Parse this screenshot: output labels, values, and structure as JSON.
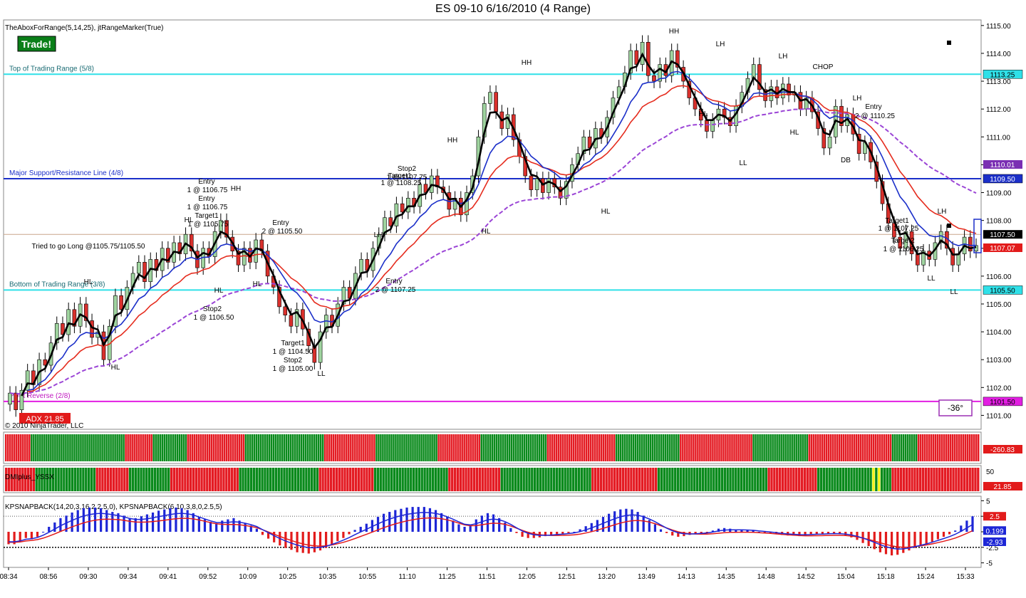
{
  "title": "ES 09-10  6/16/2010 (4 Range)",
  "indicator_label": "TheAboxForRange(5,14,25), jtRangeMarker(True)",
  "trade_badge": "Trade!",
  "copyright": "© 2010 NinjaTrader, LLC",
  "adx_badge": "ADX 21.85",
  "angle_box": "-36°",
  "panel2_label": "DMIplus_YSSX",
  "panel3_label": "KPSNAPBACK(14,20,3,16,2,2.5,0), KPSNAPBACK(6,10,3,8,0,2.5,5)",
  "colors": {
    "up_candle": "#9fd49f",
    "down_candle": "#d9302c",
    "cyan_line": "#2fe0e8",
    "blue_line": "#1b2fc9",
    "magenta_line": "#e21ee2",
    "black_ma": "#000000",
    "red_ma": "#e52c1e",
    "purple_ma": "#9b45d6",
    "hist_blue": "#1d26d6",
    "hist_red": "#e21b1b",
    "bar_green": "#0a8a1c",
    "bar_red": "#e41b23",
    "bar_yellow": "#f3f317"
  },
  "chart_data": {
    "type": "candlestick",
    "ylim": [
      1100.5,
      1115.2
    ],
    "yticks": [
      "1115.00",
      "1114.00",
      "1113.00",
      "1112.00",
      "1111.00",
      "1110.00",
      "1109.00",
      "1108.00",
      "1107.00",
      "1106.00",
      "1105.00",
      "1104.00",
      "1103.00",
      "1102.00",
      "1101.00"
    ],
    "xticks": [
      "08:34",
      "08:56",
      "09:30",
      "09:34",
      "09:41",
      "09:52",
      "10:09",
      "10:25",
      "10:35",
      "10:55",
      "11:10",
      "11:25",
      "11:51",
      "12:05",
      "12:51",
      "13:20",
      "13:49",
      "14:13",
      "14:35",
      "14:48",
      "14:52",
      "15:04",
      "15:18",
      "15:24",
      "15:33"
    ],
    "closes": [
      1101.8,
      1101.2,
      1101.9,
      1102.6,
      1102.1,
      1103.0,
      1102.8,
      1103.6,
      1104.3,
      1103.9,
      1104.8,
      1104.2,
      1105.0,
      1104.4,
      1103.8,
      1104.0,
      1103.0,
      1104.2,
      1105.3,
      1104.8,
      1105.6,
      1106.1,
      1106.5,
      1105.8,
      1106.6,
      1106.2,
      1107.0,
      1106.5,
      1107.2,
      1106.8,
      1107.5,
      1106.9,
      1106.3,
      1107.0,
      1106.7,
      1107.6,
      1108.0,
      1107.4,
      1106.9,
      1106.4,
      1107.0,
      1106.5,
      1107.3,
      1106.9,
      1106.0,
      1105.6,
      1104.9,
      1104.6,
      1104.2,
      1104.8,
      1104.1,
      1103.5,
      1102.9,
      1104.0,
      1104.6,
      1104.2,
      1105.0,
      1105.6,
      1105.2,
      1106.1,
      1106.6,
      1106.2,
      1107.0,
      1107.5,
      1108.1,
      1107.8,
      1108.6,
      1108.3,
      1108.8,
      1108.5,
      1109.3,
      1109.0,
      1109.6,
      1109.2,
      1109.0,
      1108.4,
      1108.8,
      1108.2,
      1109.0,
      1109.6,
      1111.0,
      1112.2,
      1112.6,
      1111.9,
      1111.3,
      1111.8,
      1110.9,
      1110.3,
      1109.6,
      1109.1,
      1109.5,
      1109.0,
      1109.5,
      1109.2,
      1108.8,
      1109.4,
      1110.0,
      1110.4,
      1111.0,
      1110.6,
      1111.3,
      1111.0,
      1111.7,
      1112.4,
      1112.8,
      1113.3,
      1114.1,
      1113.6,
      1114.4,
      1113.2,
      1113.0,
      1113.6,
      1113.2,
      1114.1,
      1113.5,
      1113.0,
      1112.4,
      1112.0,
      1111.6,
      1111.2,
      1111.6,
      1112.0,
      1111.7,
      1111.4,
      1112.1,
      1112.6,
      1113.1,
      1113.6,
      1112.7,
      1112.3,
      1112.8,
      1112.4,
      1112.9,
      1112.5,
      1112.6,
      1112.0,
      1112.4,
      1111.9,
      1111.3,
      1110.6,
      1111.0,
      1112.1,
      1111.4,
      1111.8,
      1111.1,
      1110.4,
      1110.8,
      1110.1,
      1109.4,
      1108.6,
      1107.9,
      1107.4,
      1107.0,
      1107.6,
      1106.8,
      1106.4,
      1106.9,
      1106.6,
      1107.2,
      1107.6,
      1107.0,
      1106.4,
      1106.8,
      1107.4,
      1106.9,
      1107.1
    ],
    "levels": [
      {
        "label": "Top of Trading Range (5/8)",
        "value": 1113.25,
        "tag": "1113.25"
      },
      {
        "label": "Major Support/Resistance Line (4/8)",
        "value": 1109.5,
        "tag": "1109.50"
      },
      {
        "label": "Bottom of Trading Range (3/8)",
        "value": 1105.5,
        "tag": "1105.50"
      },
      {
        "label": "Pivot Reverse (2/8)",
        "value": 1101.5,
        "tag": "1101.50"
      }
    ],
    "price_tags": [
      {
        "value": 1110.01,
        "tag": "1110.01"
      },
      {
        "value": 1107.5,
        "tag": "1107.50"
      },
      {
        "value": 1107.07,
        "tag": "1107.07"
      }
    ],
    "annotations": [
      {
        "text": "HH",
        "x": 946,
        "y": 47
      },
      {
        "text": "LH",
        "x": 1011,
        "y": 65
      },
      {
        "text": "LH",
        "x": 1099,
        "y": 82
      },
      {
        "text": "CHOP",
        "x": 1155,
        "y": 97
      },
      {
        "text": "HH",
        "x": 739,
        "y": 91
      },
      {
        "text": "HH",
        "x": 635,
        "y": 200
      },
      {
        "text": "HL",
        "x": 987,
        "y": 163
      },
      {
        "text": "HL",
        "x": 1115,
        "y": 189
      },
      {
        "text": "LL",
        "x": 1043,
        "y": 232
      },
      {
        "text": "DB",
        "x": 1187,
        "y": 228
      },
      {
        "text": "LH",
        "x": 1203,
        "y": 141
      },
      {
        "text": "Entry",
        "x": 1226,
        "y": 153
      },
      {
        "text": "2 @ 1110.25",
        "x": 1228,
        "y": 166
      },
      {
        "text": "HL",
        "x": 850,
        "y": 300
      },
      {
        "text": "HL",
        "x": 682,
        "y": 328
      },
      {
        "text": "Stop2",
        "x": 571,
        "y": 240
      },
      {
        "text": "Target1",
        "x": 561,
        "y": 250
      },
      {
        "text": "1 @ 1107.75",
        "x": 571,
        "y": 252
      },
      {
        "text": "1 @ 1108.25",
        "x": 563,
        "y": 260
      },
      {
        "text": "Entry",
        "x": 290,
        "y": 258
      },
      {
        "text": "1 @ 1106.75",
        "x": 291,
        "y": 270
      },
      {
        "text": "Entry",
        "x": 290,
        "y": 282
      },
      {
        "text": "1 @ 1106.75",
        "x": 291,
        "y": 294
      },
      {
        "text": "Target1",
        "x": 290,
        "y": 306
      },
      {
        "text": "1 @ 1105.75",
        "x": 292,
        "y": 318
      },
      {
        "text": "HH",
        "x": 331,
        "y": 268
      },
      {
        "text": "HL",
        "x": 265,
        "y": 312
      },
      {
        "text": "Entry",
        "x": 394,
        "y": 316
      },
      {
        "text": "2 @ 1105.50",
        "x": 396,
        "y": 328
      },
      {
        "text": "Tried to go Long @1105.75/1105.50",
        "x": 124,
        "y": 349
      },
      {
        "text": "LH",
        "x": 531,
        "y": 333
      },
      {
        "text": "HL",
        "x": 124,
        "y": 399
      },
      {
        "text": "HL",
        "x": 307,
        "y": 411
      },
      {
        "text": "HL",
        "x": 361,
        "y": 402
      },
      {
        "text": "Entry",
        "x": 553,
        "y": 398
      },
      {
        "text": "2 @ 1107.25",
        "x": 555,
        "y": 410
      },
      {
        "text": "Stop2",
        "x": 298,
        "y": 437
      },
      {
        "text": "1 @ 1106.50",
        "x": 300,
        "y": 449
      },
      {
        "text": "HL",
        "x": 162,
        "y": 519
      },
      {
        "text": "Target1",
        "x": 411,
        "y": 485
      },
      {
        "text": "1 @ 1104.50",
        "x": 411,
        "y": 497
      },
      {
        "text": "Stop2",
        "x": 411,
        "y": 509
      },
      {
        "text": "1 @ 1105.00",
        "x": 411,
        "y": 521
      },
      {
        "text": "LL",
        "x": 451,
        "y": 528
      },
      {
        "text": "Target1",
        "x": 1259,
        "y": 313
      },
      {
        "text": "1 @ 1107.25",
        "x": 1261,
        "y": 324
      },
      {
        "text": "Target2",
        "x": 1267,
        "y": 341
      },
      {
        "text": "1 @ 1106.25",
        "x": 1268,
        "y": 353
      },
      {
        "text": "LH",
        "x": 1322,
        "y": 300
      },
      {
        "text": "LL",
        "x": 1307,
        "y": 394
      },
      {
        "text": "LL",
        "x": 1339,
        "y": 413
      }
    ],
    "kpsnap": {
      "ylim": [
        -5.5,
        5.5
      ],
      "yticks": [
        "5",
        "2.5",
        "0",
        "-2.5",
        "-5"
      ],
      "tags": [
        "2.5",
        "0.199",
        "-2.93"
      ],
      "hist": [
        -2,
        -2,
        -1.6,
        -1,
        -1.2,
        -0.8,
        0,
        0.8,
        1.5,
        2.2,
        2.6,
        3.1,
        3.5,
        3.8,
        3.9,
        3.9,
        3.8,
        3.5,
        3.2,
        3.0,
        2.6,
        2.2,
        2.2,
        2.5,
        2.8,
        3.1,
        3.4,
        3.6,
        3.8,
        3.9,
        3.8,
        3.5,
        3.0,
        2.4,
        2.0,
        1.6,
        1.4,
        1.8,
        2.0,
        2.2,
        1.8,
        1.4,
        1.0,
        0.5,
        -0.5,
        -1.1,
        -1.7,
        -2.2,
        -2.6,
        -2.9,
        -3.3,
        -3.4,
        -3.5,
        -3.3,
        -3.0,
        -2.6,
        -2.0,
        -1.5,
        -1.0,
        -0.4,
        0.3,
        0.8,
        1.3,
        1.9,
        2.4,
        2.9,
        3.2,
        3.5,
        3.7,
        3.9,
        4.0,
        4.0,
        4.0,
        3.8,
        3.5,
        3.0,
        2.4,
        1.8,
        1.2,
        0.8,
        1.2,
        2.0,
        2.6,
        3.0,
        2.8,
        2.2,
        1.5,
        0.6,
        -0.2,
        -0.8,
        -1.0,
        -1.0,
        -0.9,
        -0.7,
        -0.6,
        -0.4,
        -0.3,
        -0.2,
        0,
        0.4,
        0.9,
        1.4,
        1.9,
        2.4,
        2.9,
        3.3,
        3.6,
        3.7,
        3.6,
        3.2,
        2.6,
        1.9,
        1.2,
        0.4,
        -0.2,
        -0.6,
        -0.8,
        -0.7,
        -0.5,
        -0.3,
        -0.2,
        -0.1,
        0.2,
        0.5,
        0.6,
        0.5,
        0.4,
        0.4,
        0.3,
        0.2,
        0,
        -0.1,
        -0.2,
        -0.4,
        -0.5,
        -0.6,
        -0.6,
        -0.7,
        -0.6,
        -0.5,
        -0.4,
        -0.4,
        -0.3,
        -0.3,
        -0.4,
        -0.6,
        -0.9,
        -1.3,
        -1.8,
        -2.3,
        -2.8,
        -3.3,
        -3.6,
        -3.8,
        -3.7,
        -3.4,
        -3.0,
        -2.6,
        -2.3,
        -2.0,
        -1.6,
        -1.2,
        -0.8,
        -0.4,
        0.2,
        1.0,
        1.8,
        2.5
      ]
    }
  },
  "bars1": "RRRRRRRRRRRRGGGGGGGGGGGGGGGGGGGGGGGGGGGGGGGGGGGGGGGGGGGGRRRRRRRRRRRRRGGGGGGGGGGGGGGGGRRRRRRRRRRRRRRRRRRRRRRRRRRRGGGGGGGGGGGGGGGGGGGGGGGGGGGGGGGGGGGGGRRRRRRRRRRRRRRRRRRRRRRRRGGGGGGGGGGGGGGGGGGGGGGGGGGGGGRRRRRRRRRRRRRRRRRRRRGGGGGGGGGGGGGGGGGGGGGGGGGGGGGGGRRRRRRRRRRRRRRRRRRRRRRRRRRRRRRRRGGGGGGGGGGGGGGGGGGGGGGGGGGGGGGRRRRRRRRRRRRRRRRRRRRRRRRRRRRRRRRRRGGGGGGGGGGGGGGGGGGGGGGGGGGRRRRRRRRRRRRRRRRRRRRRRRRRRRRRRRRRRRRRRRGGGGGGGGGGGGRRRRRRRRRRRRRRRRRRRRRRRRRRRRR",
  "bars2": "RRRRRRRRRRRGGGGGGGGGGGGGGGGGGGGGGRRRRRRRRRRRRGGGGGGGGGGGGGGGRRRRRRRRRRRRRRRRRRRRRRRRRGGGGGGGGGGGGGGGGGGGGGGGGGGGGGRRRRRRRRRRRRRRRRRRRRGGGGGGGGGGGGGGGGGGGGGGGGGGGRRRRRRRRRRRRRRRRRRRGGGGGGGGGGGGGGGGGGGGGGGGGGGGGGGGGRRRRRRRRRRRRRRRRRRRRRRRRGGGGGGGGGGGGGGGGGGGGGGGGGGGGGGGGGGGGGGGGRRRRRRRRRRRRRRRRRRGGGGGGGGGGGGGGGGGGGGYGYGGGGRRRRRRRRRRRRRRRRRRRRRRRRRRRRRRRR",
  "panel_tags": {
    "bar1_tag": "-260.83",
    "bar2_top": "50",
    "bar2_tag": "21.85"
  }
}
